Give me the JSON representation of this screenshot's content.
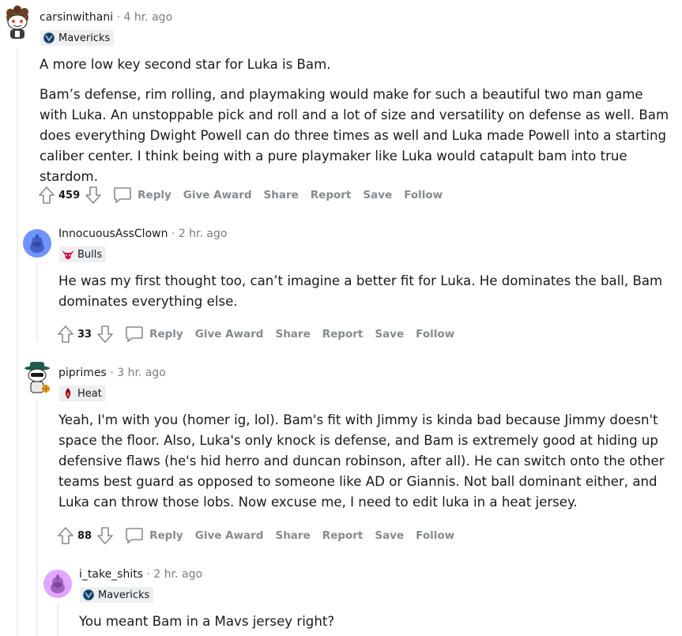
{
  "comments": [
    {
      "author": "carsinwithani",
      "time": "4 hr. ago",
      "flair": "Mavericks",
      "flair_icon": "mavericks-logo-icon",
      "paragraphs": [
        "A more low key second star for Luka is Bam.",
        "Bam’s defense, rim rolling, and playmaking would make for such a beautiful two man game with Luka. An unstoppable pick and roll and a lot of size and versatility on defense as well. Bam does everything Dwight Powell can do three times as well and Luka made Powell into a starting caliber center. I think being with a pure playmaker like Luka would catapult bam into true stardom."
      ],
      "votes": "459"
    },
    {
      "author": "InnocuousAssClown",
      "time": "2 hr. ago",
      "flair": "Bulls",
      "flair_icon": "bulls-logo-icon",
      "paragraphs": [
        "He was my first thought too, can’t imagine a better fit for Luka. He dominates the ball, Bam dominates everything else."
      ],
      "votes": "33"
    },
    {
      "author": "piprimes",
      "time": "3 hr. ago",
      "flair": "Heat",
      "flair_icon": "heat-logo-icon",
      "paragraphs": [
        "Yeah, I'm with you (homer ig, lol). Bam's fit with Jimmy is kinda bad because Jimmy doesn't space the floor. Also, Luka's only knock is defense, and Bam is extremely good at hiding up defensive flaws (he's hid herro and duncan robinson, after all). He can switch onto the other teams best guard as opposed to someone like AD or Giannis. Not ball dominant either, and Luka can throw those lobs. Now excuse me, I need to edit luka in a heat jersey."
      ],
      "votes": "88"
    },
    {
      "author": "i_take_shits",
      "time": "2 hr. ago",
      "flair": "Mavericks",
      "flair_icon": "mavericks-logo-icon",
      "paragraphs": [
        "You meant Bam in a Mavs jersey right?"
      ]
    }
  ],
  "actions": {
    "reply": "Reply",
    "give_award": "Give Award",
    "share": "Share",
    "report": "Report",
    "save": "Save",
    "follow": "Follow"
  },
  "separator": "·",
  "colors": {
    "background": "#ffffff",
    "thread_line": "#edeff1",
    "meta_gray": "#7c7c7c",
    "action_gray": "#878a8c",
    "flair_bg": "#edeff1"
  }
}
